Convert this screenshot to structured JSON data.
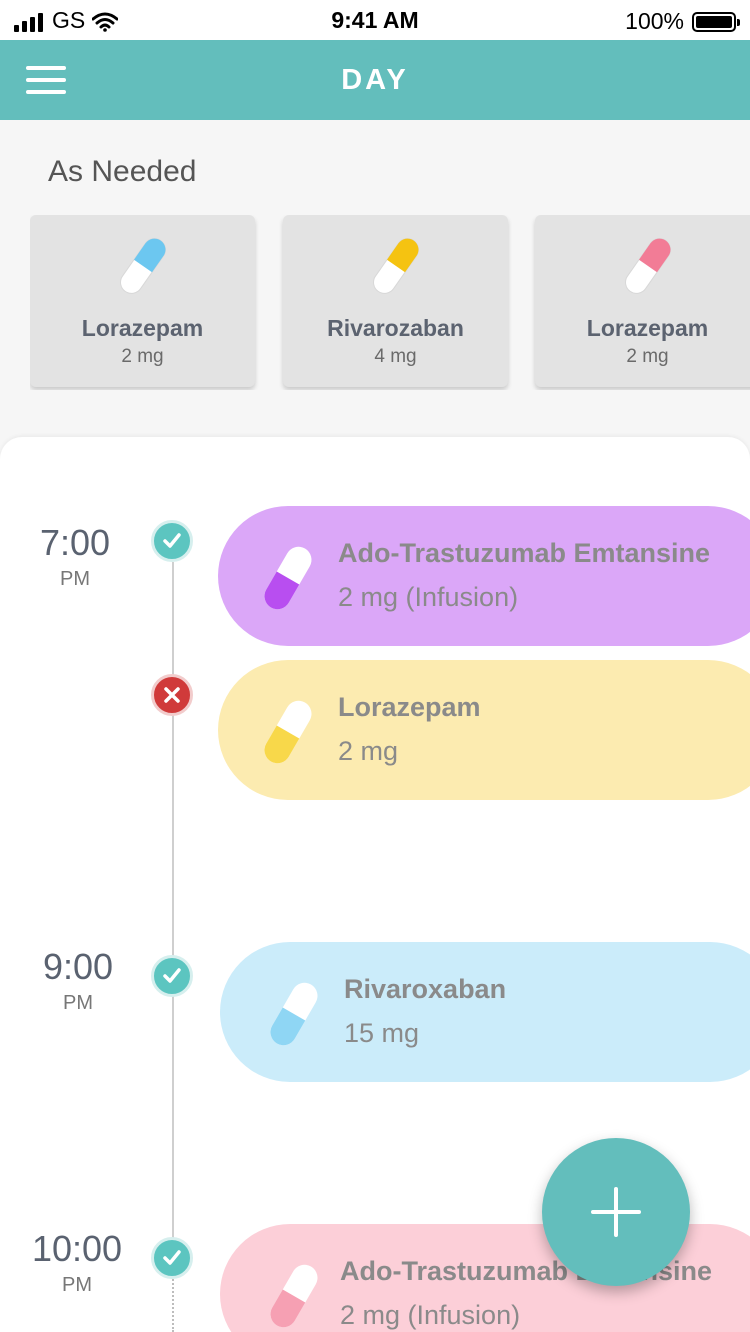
{
  "status_bar": {
    "carrier": "GS",
    "time": "9:41 AM",
    "battery": "100%"
  },
  "header": {
    "title": "DAY",
    "menu_icon": "hamburger-menu-icon"
  },
  "as_needed": {
    "title": "As Needed",
    "cards": [
      {
        "name": "Lorazepam",
        "dose": "2 mg",
        "color": "#6cc7f0"
      },
      {
        "name": "Rivarozaban",
        "dose": "4 mg",
        "color": "#f5c311"
      },
      {
        "name": "Lorazepam",
        "dose": "2 mg",
        "color": "#f27c96"
      }
    ]
  },
  "timeline": {
    "groups": [
      {
        "time": "7:00",
        "ampm": "PM"
      },
      {
        "time": "9:00",
        "ampm": "PM"
      },
      {
        "time": "10:00",
        "ampm": "PM"
      }
    ],
    "doses": [
      {
        "name": "Ado-Trastuzumab Emtansine",
        "dose": "2 mg (Infusion)",
        "status": "taken",
        "bg": "#dba7f8",
        "pill": "#b84ef0"
      },
      {
        "name": "Lorazepam",
        "dose": "2 mg",
        "status": "missed",
        "bg": "#fcebb0",
        "pill": "#f8d84a"
      },
      {
        "name": "Rivaroxaban",
        "dose": "15 mg",
        "status": "taken",
        "bg": "#cbecfa",
        "pill": "#8fd6f4"
      },
      {
        "name": "Ado-Trastuzumab Emtansine",
        "dose": "2 mg (Infusion)",
        "status": "taken",
        "bg": "#fccfd8",
        "pill": "#f6a0b3"
      }
    ]
  },
  "fab": {
    "icon": "plus-icon"
  }
}
